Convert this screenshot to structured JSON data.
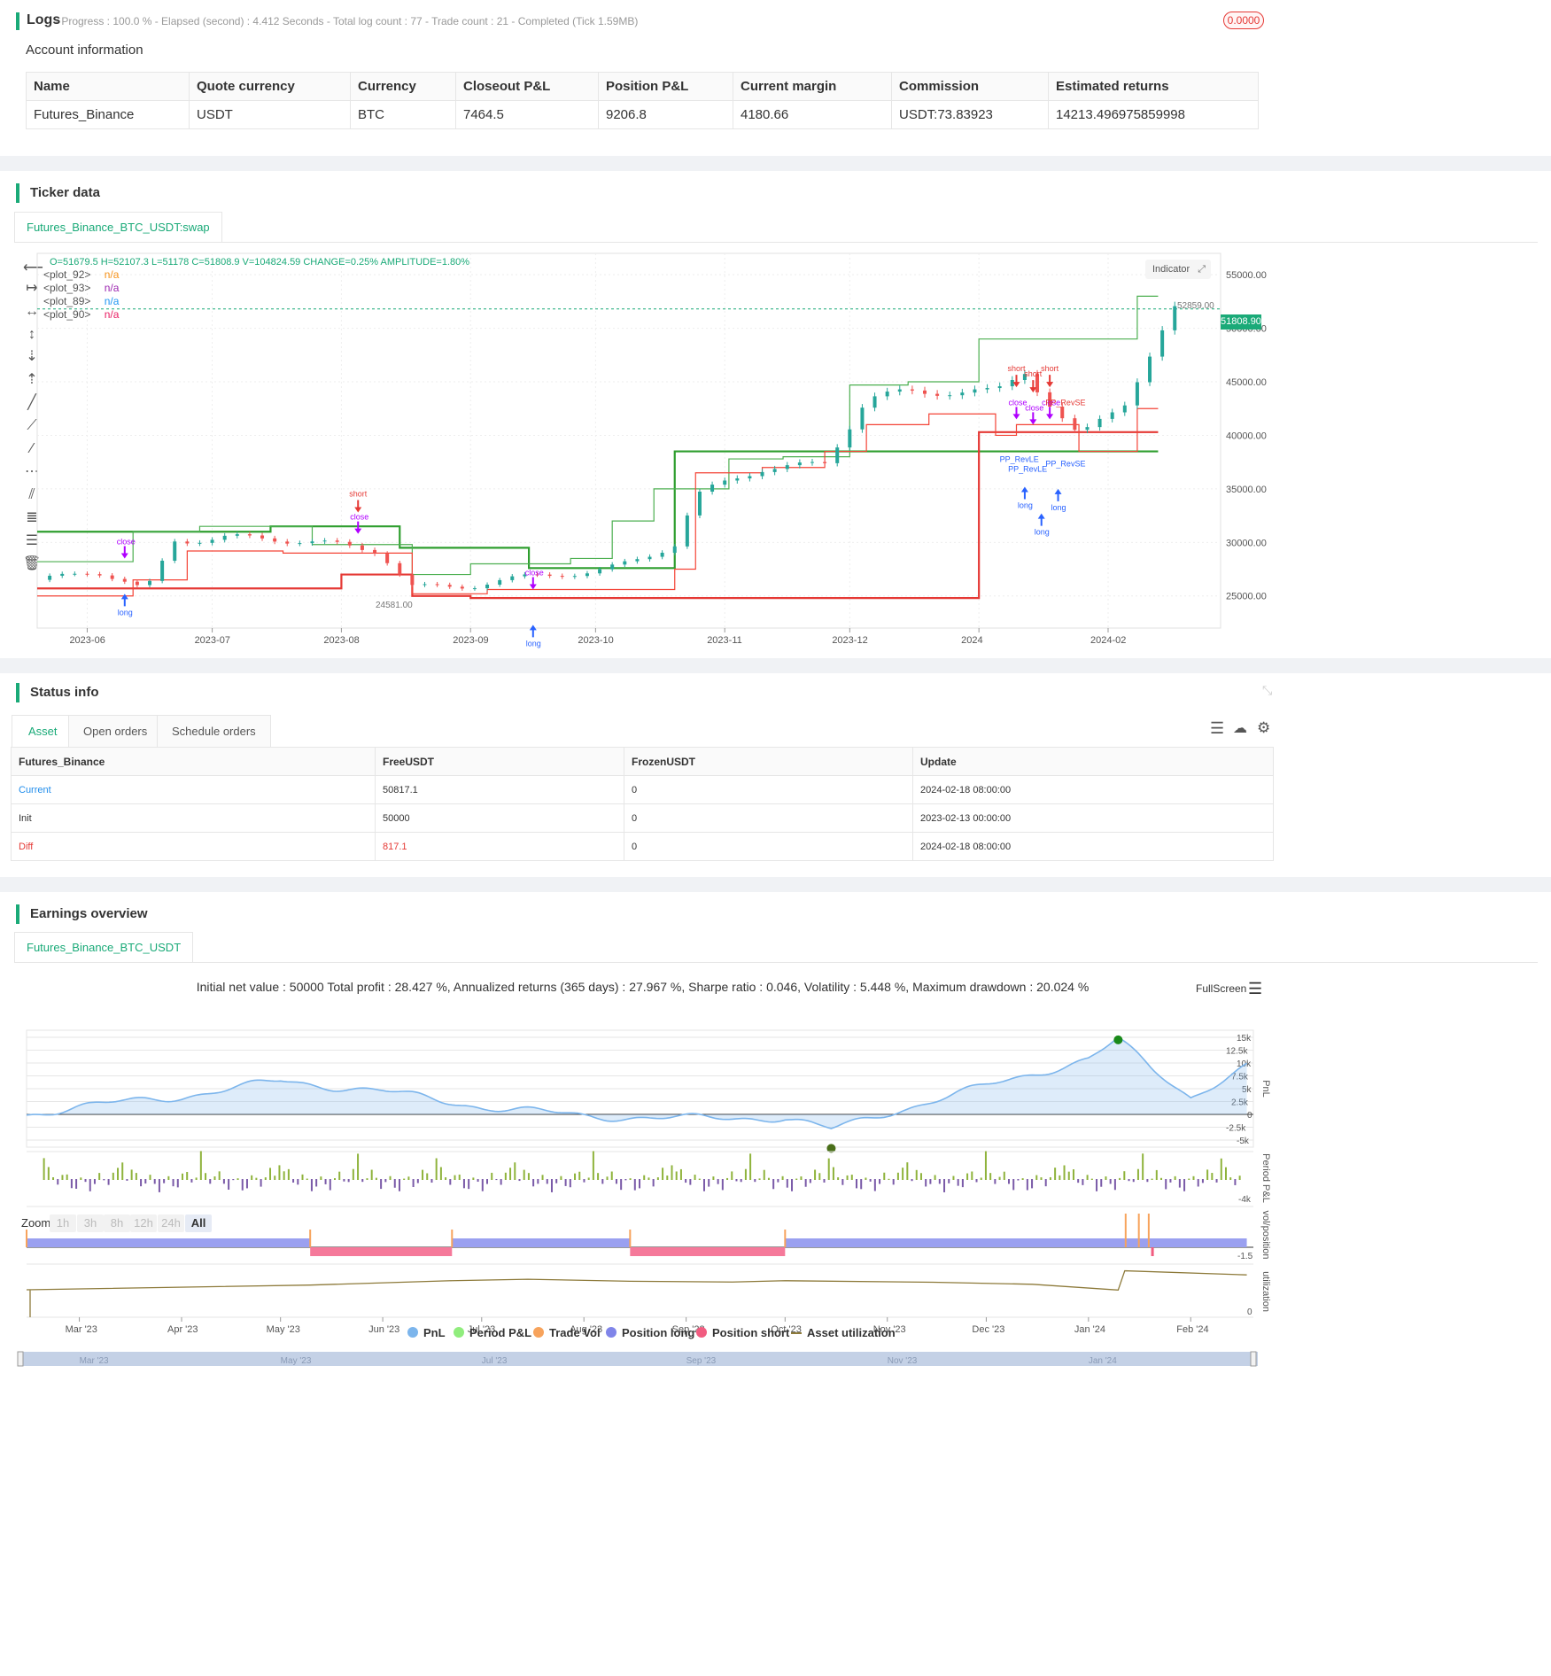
{
  "logs": {
    "title": "Logs",
    "summary": "- Progress : 100.0 % - Elapsed (second) : 4.412  Seconds - Total log count : 77 - Trade count : 21 - Completed (Tick 1.59MB)",
    "badge": "0.0000"
  },
  "account": {
    "title": "Account information",
    "columns": [
      "Name",
      "Quote currency",
      "Currency",
      "Closeout P&L",
      "Position P&L",
      "Current margin",
      "Commission",
      "Estimated returns"
    ],
    "row": [
      "Futures_Binance",
      "USDT",
      "BTC",
      "7464.5",
      "9206.8",
      "4180.66",
      "USDT:73.83923",
      "14213.496975859998"
    ]
  },
  "ticker": {
    "title": "Ticker data",
    "tab": "Futures_Binance_BTC_USDT:swap",
    "ohlc": "O=51679.5 H=52107.3 L=51178 C=51808.9 V=104824.59 CHANGE=0.25% AMPLITUDE=1.80%",
    "plots": [
      {
        "name": "<plot_92>",
        "value": "n/a",
        "color": "#f7931a"
      },
      {
        "name": "<plot_93>",
        "value": "n/a",
        "color": "#9c27b0"
      },
      {
        "name": "<plot_89>",
        "value": "n/a",
        "color": "#2196f3"
      },
      {
        "name": "<plot_90>",
        "value": "n/a",
        "color": "#e91e63"
      }
    ],
    "indicator_btn": "Indicator",
    "y_ticks": [
      "55000.00",
      "50000.00",
      "45000.00",
      "40000.00",
      "35000.00",
      "30000.00",
      "25000.00"
    ],
    "x_ticks": [
      "2023-06",
      "2023-07",
      "2023-08",
      "2023-09",
      "2023-10",
      "2023-11",
      "2023-12",
      "2024",
      "2024-02"
    ],
    "last_price": "51808.90",
    "high_label": "52859.00",
    "low_label": "24581.00",
    "marker_labels": {
      "long": "long",
      "short": "short",
      "close": "close",
      "pp_revle": "PP_RevLE",
      "pp_revse": "PP_RevSE"
    }
  },
  "status": {
    "title": "Status info",
    "tabs": [
      "Asset",
      "Open orders",
      "Schedule orders"
    ],
    "columns": [
      "Futures_Binance",
      "FreeUSDT",
      "FrozenUSDT",
      "Update"
    ],
    "rows": [
      {
        "label": "Current",
        "free": "50817.1",
        "frozen": "0",
        "update": "2024-02-18 08:00:00",
        "color": "#1f8ceb"
      },
      {
        "label": "Init",
        "free": "50000",
        "frozen": "0",
        "update": "2023-02-13 00:00:00",
        "color": "#333333"
      },
      {
        "label": "Diff",
        "free": "817.1",
        "frozen": "0",
        "update": "2024-02-18 08:00:00",
        "color": "#e53935"
      }
    ]
  },
  "earnings": {
    "title": "Earnings overview",
    "tab": "Futures_Binance_BTC_USDT",
    "summary": "Initial net value : 50000 Total profit : 28.427 %, Annualized returns (365 days) : 27.967 %, Sharpe ratio : 0.046, Volatility : 5.448 %, Maximum drawdown : 20.024 %",
    "fullscreen": "FullScreen",
    "zoom_label": "Zoom",
    "zoom_buttons": [
      "1h",
      "3h",
      "8h",
      "12h",
      "24h",
      "All"
    ],
    "pnl_ticks": [
      "15k",
      "12.5k",
      "10k",
      "7.5k",
      "5k",
      "2.5k",
      "0",
      "-2.5k",
      "-5k"
    ],
    "period_tick": "-4k",
    "pos_tick": "-1.5",
    "util_tick": "0",
    "axis_titles": {
      "pnl": "PnL",
      "period": "Period P&L",
      "pos": "vol/position",
      "util": "utilization"
    },
    "months": [
      "Mar '23",
      "Apr '23",
      "May '23",
      "Jun '23",
      "Jul '23",
      "Aug '23",
      "Sep '23",
      "Oct '23",
      "Nov '23",
      "Dec '23",
      "Jan '24",
      "Feb '24"
    ],
    "nav_months": [
      "Mar '23",
      "May '23",
      "Jul '23",
      "Sep '23",
      "Nov '23",
      "Jan '24"
    ],
    "legend": [
      {
        "label": "PnL",
        "color": "#7cb5ec"
      },
      {
        "label": "Period P&L",
        "color": "#90ed7d"
      },
      {
        "label": "Trade Vol",
        "color": "#f7a35c"
      },
      {
        "label": "Position long",
        "color": "#8085e9"
      },
      {
        "label": "Position short",
        "color": "#f15c80"
      },
      {
        "label": "Asset utilization",
        "color": "#8d7a3a"
      }
    ]
  },
  "chart_data": [
    {
      "type": "candlestick",
      "x": [
        "2023-05-23",
        "2023-06-03",
        "2023-06-15",
        "2023-06-22",
        "2023-07-05",
        "2023-07-20",
        "2023-08-10",
        "2023-08-18",
        "2023-09-01",
        "2023-09-15",
        "2023-10-01",
        "2023-10-20",
        "2023-10-25",
        "2023-11-10",
        "2023-11-25",
        "2023-12-05",
        "2023-12-20",
        "2024-01-05",
        "2024-01-12",
        "2024-01-25",
        "2024-02-05",
        "2024-02-18"
      ],
      "close": [
        26500,
        27000,
        25500,
        30500,
        30700,
        29800,
        29400,
        26200,
        25800,
        26500,
        27500,
        29800,
        34000,
        36700,
        37800,
        43800,
        43500,
        44000,
        46500,
        40000,
        42800,
        51808.9
      ],
      "ylim": [
        22000,
        57000
      ]
    },
    {
      "type": "area",
      "x": [
        "2023-02-13",
        "2023-03-01",
        "2023-04-01",
        "2023-05-01",
        "2023-06-01",
        "2023-07-01",
        "2023-08-01",
        "2023-09-01",
        "2023-10-01",
        "2023-10-15",
        "2023-11-01",
        "2023-12-01",
        "2024-01-01",
        "2024-01-10",
        "2024-01-20",
        "2024-02-01",
        "2024-02-18"
      ],
      "y": [
        0,
        1500,
        3500,
        6500,
        4500,
        1500,
        -300,
        -800,
        -600,
        -3000,
        300,
        5500,
        10800,
        14500,
        9000,
        3500,
        9200
      ],
      "ylim": [
        -5000,
        15000
      ]
    }
  ]
}
